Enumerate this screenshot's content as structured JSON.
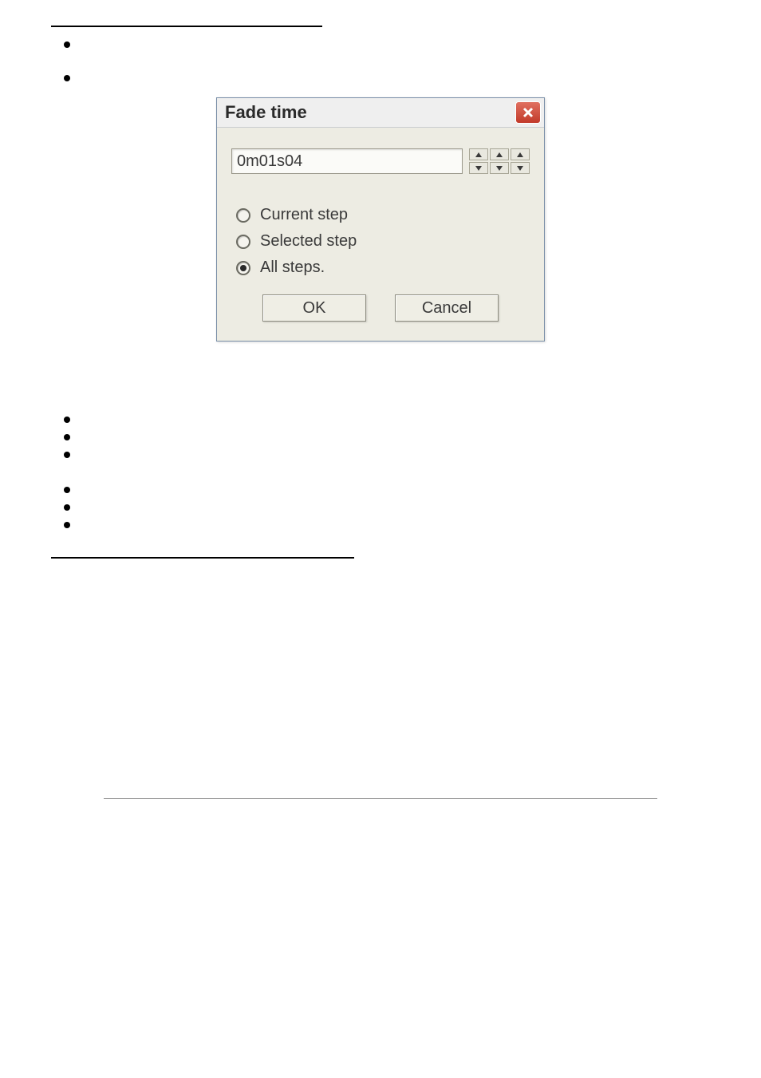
{
  "dialog": {
    "title": "Fade time",
    "input_value": "0m01s04",
    "radios": {
      "current_step": "Current step",
      "selected_step": "Selected step",
      "all_steps": "All steps.",
      "selected_index": 2
    },
    "ok_label": "OK",
    "cancel_label": "Cancel"
  }
}
